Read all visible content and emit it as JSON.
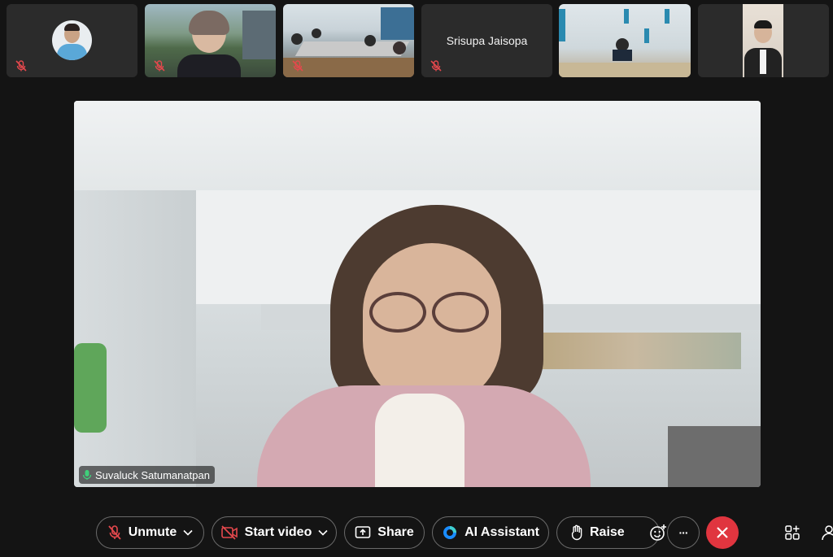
{
  "participants": [
    {
      "name": "",
      "muted": true
    },
    {
      "name": "",
      "muted": true
    },
    {
      "name": "",
      "muted": true
    },
    {
      "name": "Srisupa Jaisopa",
      "muted": true
    },
    {
      "name": "",
      "muted": false
    },
    {
      "name": "",
      "muted": false
    }
  ],
  "active_speaker": {
    "name": "Suvaluck Satumanatpan"
  },
  "toolbar": {
    "unmute_label": "Unmute",
    "start_video_label": "Start video",
    "share_label": "Share",
    "ai_assistant_label": "AI Assistant",
    "raise_label": "Raise",
    "more_label": "···"
  },
  "colors": {
    "background": "#141414",
    "tile": "#262626",
    "muted_red": "#e5484d",
    "end_call_red": "#e0353f",
    "speaking_green": "#3fd07a"
  }
}
